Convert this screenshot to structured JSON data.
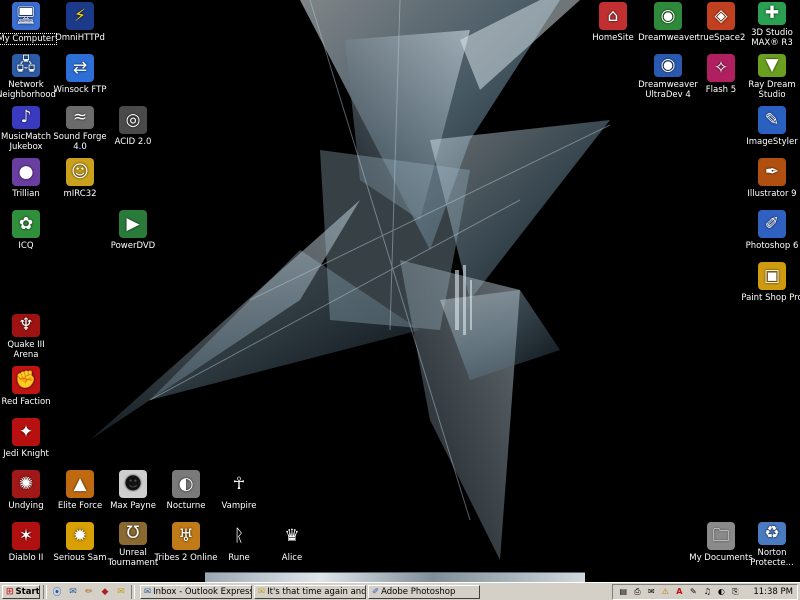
{
  "desktop": {
    "icons": [
      {
        "label": "My Computer",
        "glyph": "🖥",
        "color": "#3a6fd0"
      },
      {
        "label": "OmniHTTPd",
        "glyph": "⚡",
        "color": "#1b3a8a"
      },
      {
        "label": "Network\nNeighborhood",
        "glyph": "🖧",
        "color": "#2c5ca8"
      },
      {
        "label": "Winsock FTP",
        "glyph": "⇄",
        "color": "#2d6fd6"
      },
      {
        "label": "MusicMatch\nJukebox",
        "glyph": "♪",
        "color": "#3a3ac0"
      },
      {
        "label": "Sound Forge\n4.0",
        "glyph": "≈",
        "color": "#6b6b6b"
      },
      {
        "label": "ACID 2.0",
        "glyph": "◎",
        "color": "#4a4a4a"
      },
      {
        "label": "Trillian",
        "glyph": "●",
        "color": "#6a3da0"
      },
      {
        "label": "mIRC32",
        "glyph": "☺",
        "color": "#c9a11c"
      },
      {
        "label": "ICQ",
        "glyph": "✿",
        "color": "#2f8f3a"
      },
      {
        "label": "PowerDVD",
        "glyph": "▶",
        "color": "#2a7a3a"
      },
      {
        "label": "Quake III\nArena",
        "glyph": "♆",
        "color": "#9e1212"
      },
      {
        "label": "Red Faction",
        "glyph": "✊",
        "color": "#c01414"
      },
      {
        "label": "Jedi Knight",
        "glyph": "✦",
        "color": "#b81010"
      },
      {
        "label": "Undying",
        "glyph": "✺",
        "color": "#a01818"
      },
      {
        "label": "Elite Force",
        "glyph": "▲",
        "color": "#c06a10"
      },
      {
        "label": "Max Payne",
        "glyph": "☻",
        "color": "#cfcfcf"
      },
      {
        "label": "Nocturne",
        "glyph": "◐",
        "color": "#7a7a7a"
      },
      {
        "label": "Vampire",
        "glyph": "☥",
        "color": "#c8c8c8"
      },
      {
        "label": "Diablo II",
        "glyph": "✶",
        "color": "#b01010"
      },
      {
        "label": "Serious Sam",
        "glyph": "✹",
        "color": "#d8a000"
      },
      {
        "label": "Unreal\nTournament",
        "glyph": "Ʊ",
        "color": "#8a6a30"
      },
      {
        "label": "Tribes 2 Online",
        "glyph": "♅",
        "color": "#c07a18"
      },
      {
        "label": "Rune",
        "glyph": "ᚱ",
        "color": "#e0e0e0"
      },
      {
        "label": "Alice",
        "glyph": "♛",
        "color": "#c0c0c0"
      },
      {
        "label": "HomeSite",
        "glyph": "⌂",
        "color": "#c03030"
      },
      {
        "label": "Dreamweaver",
        "glyph": "◉",
        "color": "#2e8a3a"
      },
      {
        "label": "trueSpace2",
        "glyph": "◈",
        "color": "#c04020"
      },
      {
        "label": "3D Studio\nMAX® R3",
        "glyph": "✚",
        "color": "#2aa050"
      },
      {
        "label": "Dreamweaver\nUltraDev 4",
        "glyph": "◉",
        "color": "#2a5ab0"
      },
      {
        "label": "Flash 5",
        "glyph": "✧",
        "color": "#b02060"
      },
      {
        "label": "Ray Dream\nStudio",
        "glyph": "▼",
        "color": "#6aa020"
      },
      {
        "label": "ImageStyler",
        "glyph": "✎",
        "color": "#2a60c0"
      },
      {
        "label": "Illustrator 9",
        "glyph": "✒",
        "color": "#b05010"
      },
      {
        "label": "Photoshop 6",
        "glyph": "✐",
        "color": "#3060c0"
      },
      {
        "label": "Paint Shop Pro",
        "glyph": "▣",
        "color": "#d09a10"
      },
      {
        "label": "My Documents",
        "glyph": "🗀",
        "color": "#8a8a8a"
      },
      {
        "label": "Norton\nProtecte...",
        "glyph": "♻",
        "color": "#4a7ac0"
      }
    ]
  },
  "taskbar": {
    "start_label": "Start",
    "quick_launch": [
      "⦿",
      "✉",
      "✏",
      "◆",
      "✉"
    ],
    "tasks": [
      {
        "label": "Inbox - Outlook Express",
        "glyph": "✉"
      },
      {
        "label": "It's that time again and fo...",
        "glyph": "✉"
      },
      {
        "label": "Adobe Photoshop",
        "glyph": "✐"
      }
    ],
    "tray_icons": [
      "▤",
      "⎙",
      "✉",
      "⚠",
      "A",
      "✎",
      "♫",
      "◐",
      "⎘"
    ],
    "clock": "11:38 PM"
  },
  "colors": {
    "taskbar_bg": "#d4d0c8",
    "desktop_bg": "#000000"
  }
}
